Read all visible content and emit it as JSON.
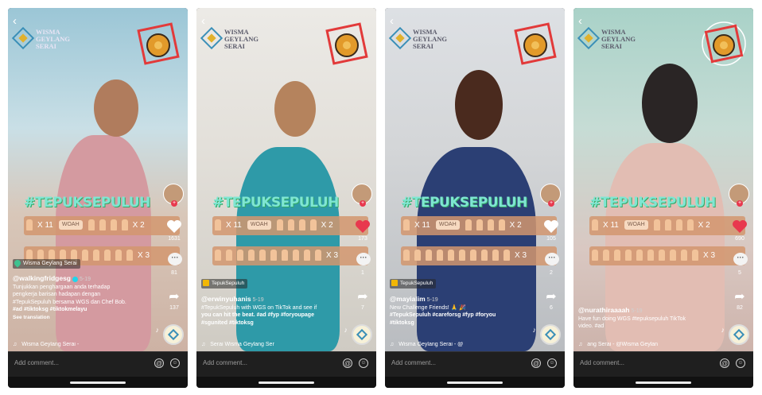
{
  "brand": {
    "logo_text": "WISMA\nGEYLANG\nSERAI",
    "accent": "#7fe6d2",
    "like_red": "#e8384e"
  },
  "shared": {
    "hashtag_banner": "#TEPUKSEPULUH",
    "clap_row1_x11": "X 11",
    "clap_row1_woah": "WOAH",
    "clap_row1_x2": "X 2",
    "clap_row2_x3": "X 3",
    "comment_placeholder": "Add comment...",
    "at_icon": "@",
    "emoji_icon": "☺"
  },
  "phones": [
    {
      "location_tag": "Wisma Geylang Serai",
      "username": "@walkingfridgesg",
      "verified": true,
      "date": "5-19",
      "caption_l1": "Tunjukkan penghargaan anda terhadap",
      "caption_l2": "pengkerja barisan hadapan dengan",
      "caption_l3": "#TepukSepuluh bersama WGS dan Chef Bob.",
      "caption_l4": "#ad #tiktoksg #tiktokmelayu",
      "see_translation": "See translation",
      "music": "Wisma Geylang Serai - ",
      "likes": "1631",
      "comments": "81",
      "shares": "137",
      "liked": false
    },
    {
      "category_tag": "TepukSepuluh",
      "username": "@erwinyuhanis",
      "date": "5-19",
      "caption_l1": "#TepukSepuluh with WGS on TikTok and see if",
      "caption_l2": "you can hit the beat. #ad #fyp #foryoupage",
      "caption_l3": "#sgunited #tiktoksg",
      "music": "Serai    Wisma Geylang Ser",
      "likes": "173",
      "comments": "1",
      "shares": "7",
      "liked": true
    },
    {
      "category_tag": "TepukSepuluh",
      "username": "@mayialim",
      "date": "5-19",
      "caption_l1": "New Challenge Friends! 🙏 🎉",
      "caption_l2": "#TepukSepuluh #careforsg #fyp #foryou",
      "caption_l3": "#tiktoksg",
      "music": "Wisma Geylang Serai - @",
      "likes": "105",
      "comments": "2",
      "shares": "6",
      "liked": false
    },
    {
      "username": "@nurathiraaaah",
      "date": "5-19",
      "caption_l1": "Have fun doing WGS #tepuksepuluh TikTok",
      "caption_l2": "video. #ad",
      "music": "ang Serai - @Wisma Geylan",
      "likes": "690",
      "comments": "5",
      "shares": "82",
      "liked": true
    }
  ]
}
